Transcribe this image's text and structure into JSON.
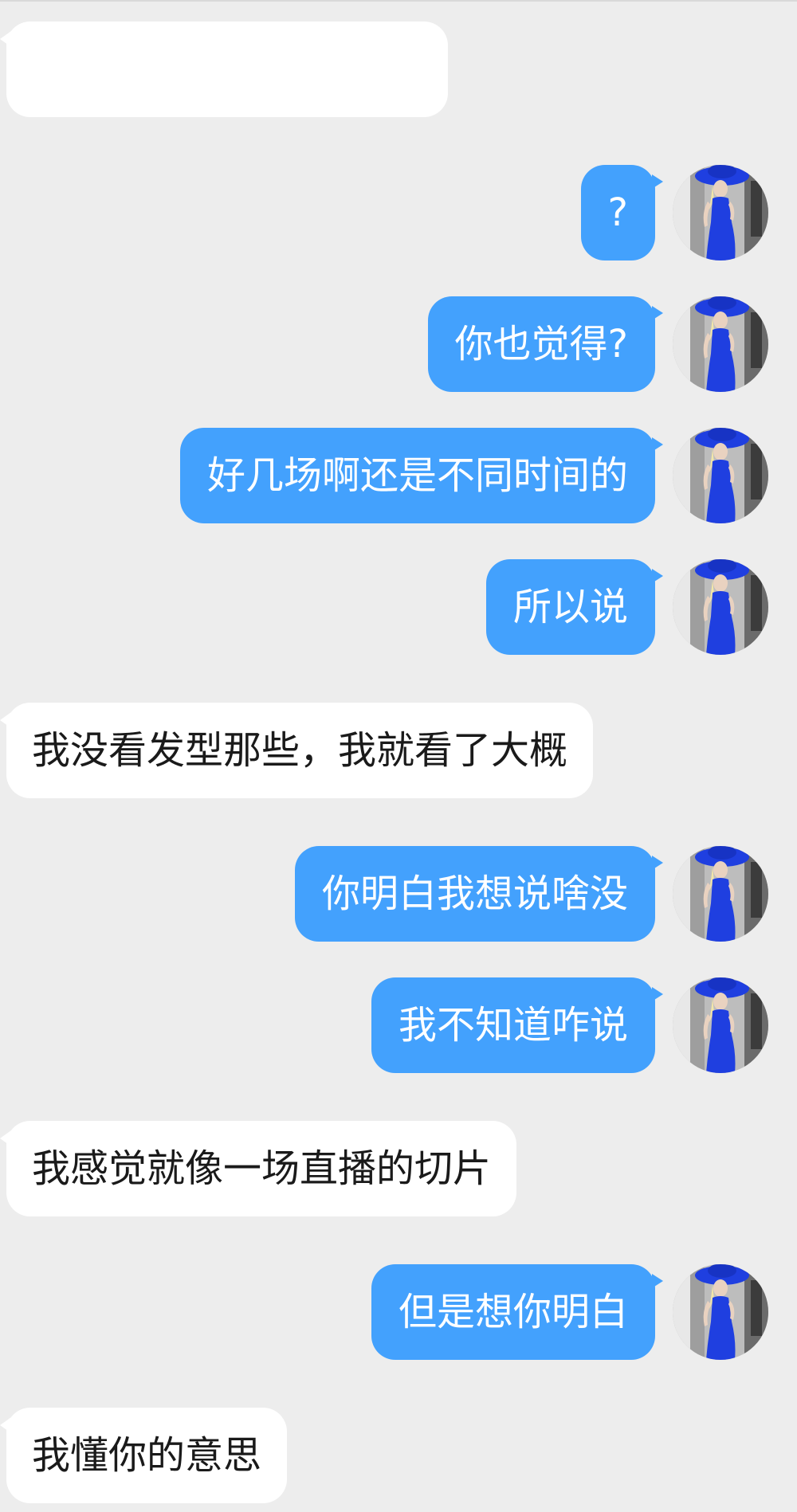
{
  "chat": {
    "messages": [
      {
        "side": "in",
        "text": ""
      },
      {
        "side": "out",
        "text": "?"
      },
      {
        "side": "out",
        "text": "你也觉得?"
      },
      {
        "side": "out",
        "text": "好几场啊还是不同时间的"
      },
      {
        "side": "out",
        "text": "所以说"
      },
      {
        "side": "in",
        "text": "我没看发型那些，我就看了大概"
      },
      {
        "side": "out",
        "text": "你明白我想说啥没"
      },
      {
        "side": "out",
        "text": "我不知道咋说"
      },
      {
        "side": "in",
        "text": "我感觉就像一场直播的切片"
      },
      {
        "side": "out",
        "text": "但是想你明白"
      },
      {
        "side": "in",
        "text": "我懂你的意思"
      }
    ]
  },
  "colors": {
    "background": "#ededed",
    "incoming_bubble": "#ffffff",
    "outgoing_bubble": "#43a1fd",
    "incoming_text": "#1a1a1a",
    "outgoing_text": "#ffffff",
    "avatar_dress": "#1f3fe0"
  },
  "icons": {
    "avatar": "avatar-photo-icon"
  }
}
